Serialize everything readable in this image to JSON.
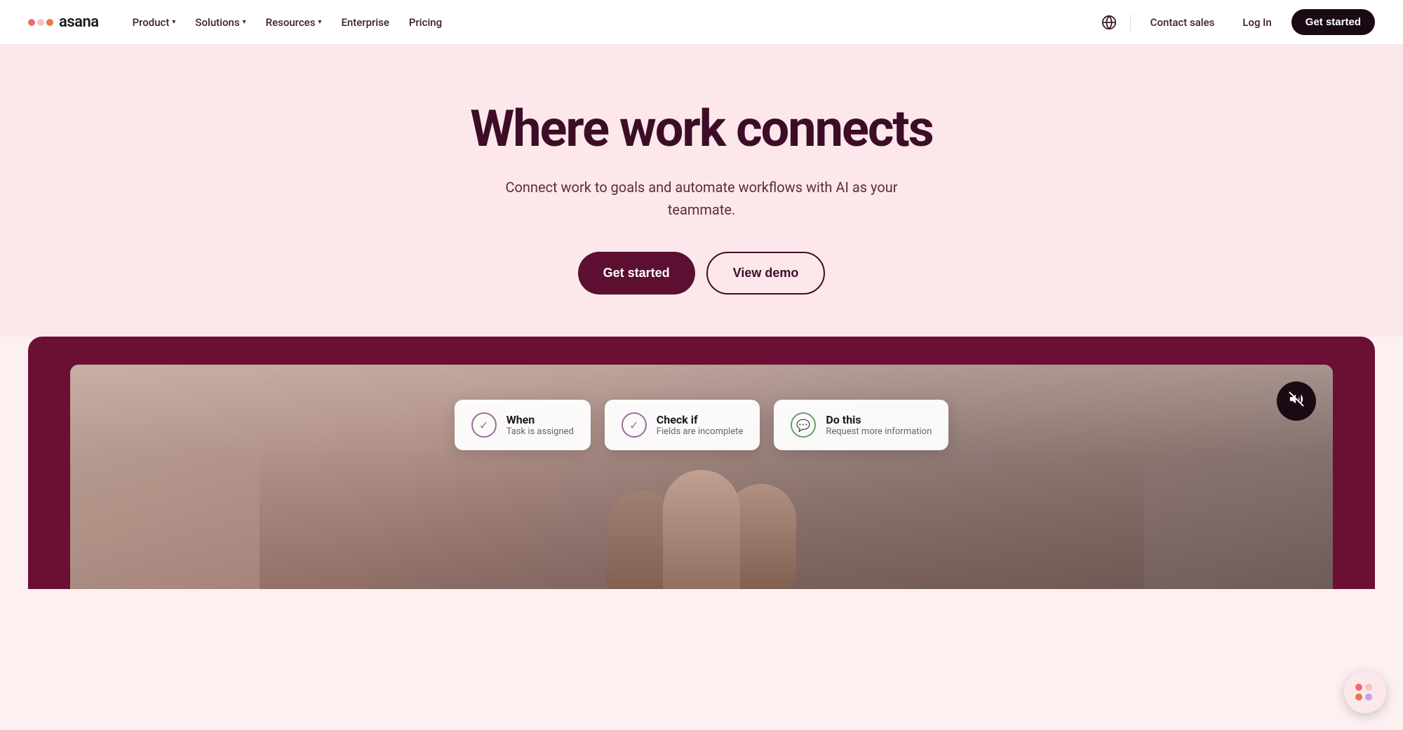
{
  "brand": {
    "name": "asana",
    "logo_alt": "Asana logo"
  },
  "nav": {
    "product_label": "Product",
    "solutions_label": "Solutions",
    "resources_label": "Resources",
    "enterprise_label": "Enterprise",
    "pricing_label": "Pricing",
    "contact_sales_label": "Contact sales",
    "login_label": "Log In",
    "get_started_label": "Get started"
  },
  "hero": {
    "title": "Where work connects",
    "subtitle": "Connect work to goals and automate workflows with AI as your teammate.",
    "get_started_label": "Get started",
    "view_demo_label": "View demo"
  },
  "workflow": {
    "card1": {
      "title": "When",
      "subtitle": "Task is assigned"
    },
    "card2": {
      "title": "Check if",
      "subtitle": "Fields are incomplete"
    },
    "card3": {
      "title": "Do this",
      "subtitle": "Request more information"
    }
  },
  "icons": {
    "chevron": "▾",
    "globe": "🌐",
    "check": "✓",
    "chat": "💬",
    "mute": "🔇"
  }
}
